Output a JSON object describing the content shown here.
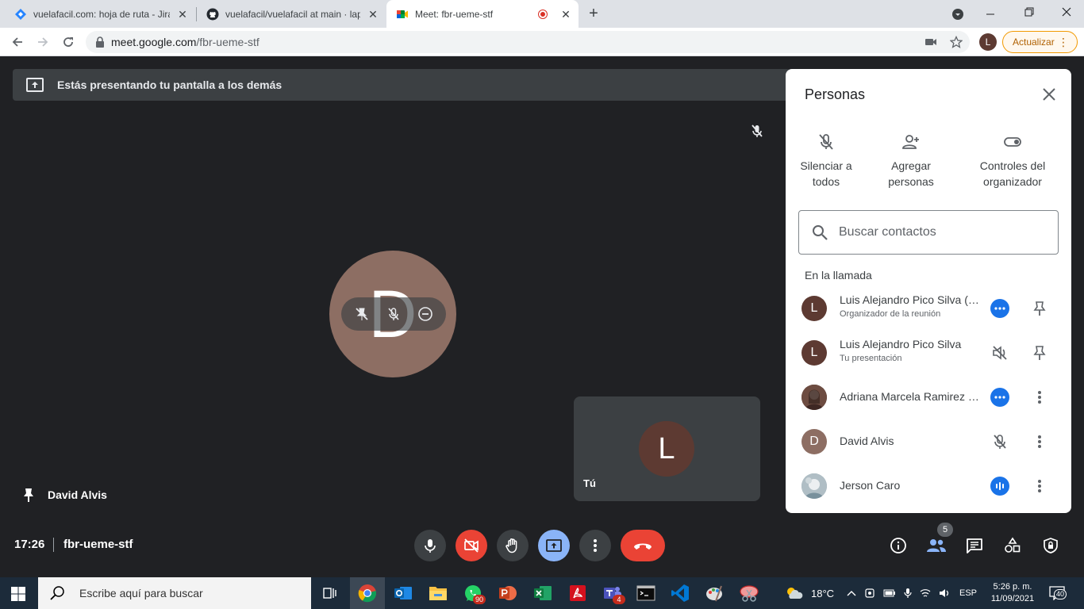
{
  "browser": {
    "tabs": [
      {
        "title": "vuelafacil.com: hoja de ruta - Jira",
        "close": "✕"
      },
      {
        "title": "vuelafacil/vuelafacil at main · lap",
        "close": "✕"
      },
      {
        "title": "Meet: fbr-ueme-stf",
        "close": "✕"
      }
    ],
    "new_tab": "+",
    "url_host": "meet.google.com",
    "url_path": "/fbr-ueme-stf",
    "profile_initial": "L",
    "update_label": "Actualizar"
  },
  "meet": {
    "presenting_banner": "Estás presentando tu pantalla a los demás",
    "main_tile_initial": "D",
    "pinned_name": "David Alvis",
    "self_tile_initial": "L",
    "self_tile_label": "Tú",
    "time": "17:26",
    "meeting_code": "fbr-ueme-stf",
    "people_count": "5"
  },
  "panel": {
    "title": "Personas",
    "quick_actions": [
      {
        "line1": "Silenciar a",
        "line2": "todos"
      },
      {
        "line1": "Agregar",
        "line2": "personas"
      },
      {
        "line1": "Controles del",
        "line2": "organizador"
      }
    ],
    "search_placeholder": "Buscar contactos",
    "section_label": "En la llamada",
    "participants": [
      {
        "initial": "L",
        "name": "Luis Alejandro Pico Silva (Tú)",
        "sub": "Organizador de la reunión",
        "color": "#5d3a32"
      },
      {
        "initial": "L",
        "name": "Luis Alejandro Pico Silva",
        "sub": "Tu presentación",
        "color": "#5d3a32"
      },
      {
        "initial": "",
        "name": "Adriana Marcela Ramirez Si...",
        "sub": "",
        "color": "#6d4c41"
      },
      {
        "initial": "D",
        "name": "David Alvis",
        "sub": "",
        "color": "#8d6e63"
      },
      {
        "initial": "",
        "name": "Jerson Caro",
        "sub": "",
        "color": "#90a4ae"
      }
    ]
  },
  "taskbar": {
    "search_placeholder": "Escribe aquí para buscar",
    "whatsapp_badge": "90",
    "teams_badge": "4",
    "weather": "18°C",
    "language": "ESP",
    "time": "5:26 p. m.",
    "date": "11/09/2021",
    "notifications": "40"
  },
  "colors": {
    "meet_bg": "#202124",
    "accent_blue": "#1a73e8",
    "danger_red": "#ea4335",
    "present_blue": "#8ab4f8",
    "update_orange": "#f29900"
  }
}
